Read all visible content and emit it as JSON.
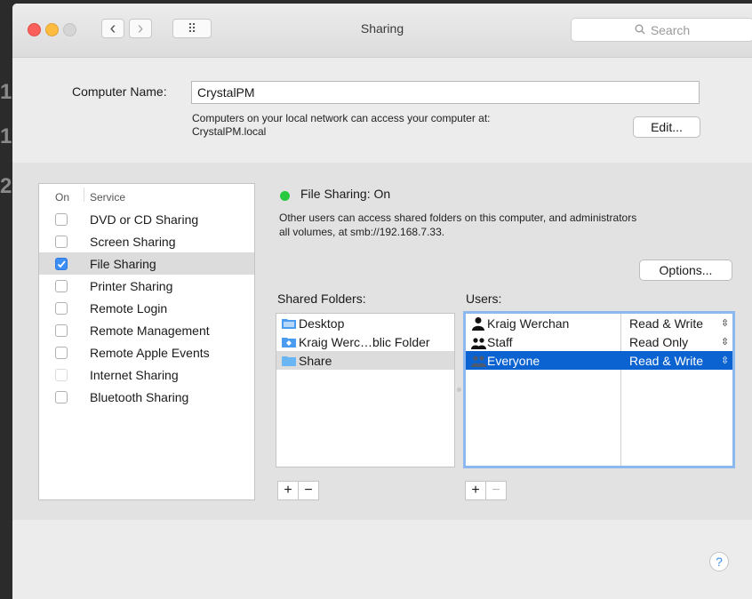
{
  "window": {
    "title": "Sharing"
  },
  "toolbar": {
    "back": "‹",
    "forward": "›",
    "grid": "⠿",
    "search_placeholder": "Search"
  },
  "computer": {
    "name_label": "Computer Name:",
    "name_value": "CrystalPM",
    "access_note": "Computers on your local network can access your computer at:",
    "local_host": "CrystalPM.local",
    "edit_label": "Edit..."
  },
  "services": {
    "header_on": "On",
    "header_service": "Service",
    "items": [
      {
        "label": "DVD or CD Sharing",
        "checked": false
      },
      {
        "label": "Screen Sharing",
        "checked": false
      },
      {
        "label": "File Sharing",
        "checked": true
      },
      {
        "label": "Printer Sharing",
        "checked": false
      },
      {
        "label": "Remote Login",
        "checked": false
      },
      {
        "label": "Remote Management",
        "checked": false
      },
      {
        "label": "Remote Apple Events",
        "checked": false
      },
      {
        "label": "Internet Sharing",
        "checked": false
      },
      {
        "label": "Bluetooth Sharing",
        "checked": false
      }
    ]
  },
  "file_sharing": {
    "status": "File Sharing: On",
    "description_line1": "Other users can access shared folders on this computer, and administrators",
    "description_line2": "all volumes, at smb://192.168.7.33.",
    "options_label": "Options..."
  },
  "shared_folders": {
    "label": "Shared Folders:",
    "items": [
      "Desktop",
      "Kraig Werc…blic Folder",
      "Share"
    ]
  },
  "users": {
    "label": "Users:",
    "items": [
      {
        "name": "Kraig Werchan",
        "permission": "Read & Write"
      },
      {
        "name": "Staff",
        "permission": "Read Only"
      },
      {
        "name": "Everyone",
        "permission": "Read & Write"
      }
    ]
  },
  "buttons": {
    "plus": "+",
    "minus": "−",
    "help": "?"
  },
  "colors": {
    "selection": "#0b63d1",
    "status_on": "#27c93f",
    "accent": "#3b8ef3"
  }
}
